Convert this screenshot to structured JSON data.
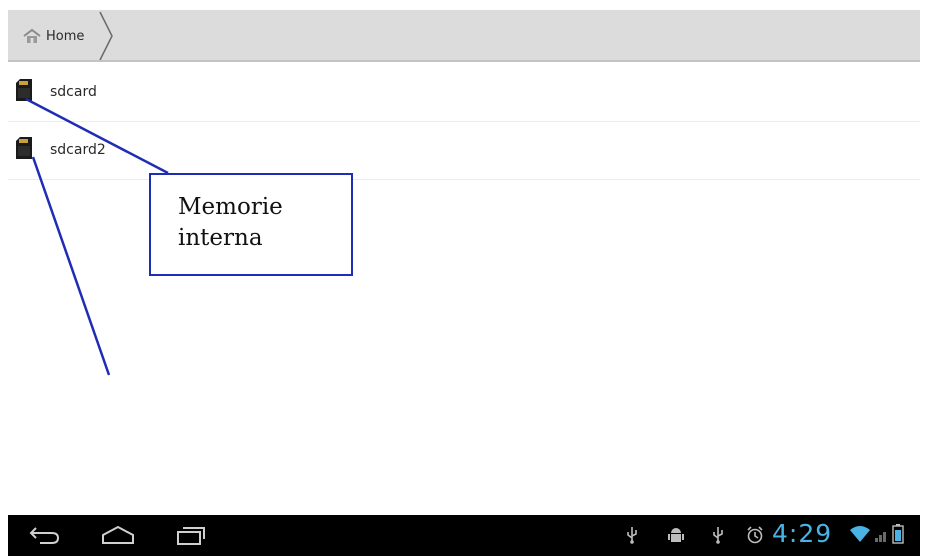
{
  "breadcrumb": {
    "home_label": "Home",
    "home_icon": "home-icon",
    "separator_icon": "chevron-right-icon"
  },
  "storage_list": [
    {
      "label": "sdcard",
      "icon": "sd-card-icon"
    },
    {
      "label": "sdcard2",
      "icon": "sd-card-icon"
    }
  ],
  "annotation": {
    "line1": "Memorie",
    "line2": "interna",
    "color": "#1f2cb5"
  },
  "nav_bar": {
    "back_icon": "back-icon",
    "home_icon": "home-outline-icon",
    "recents_icon": "recent-apps-icon"
  },
  "status_bar": {
    "time": "4:29",
    "icons": [
      "usb-icon",
      "android-debug-icon",
      "usb-icon",
      "alarm-icon",
      "wifi-icon",
      "signal-icon",
      "battery-icon"
    ],
    "clock_color": "#4ab3e6"
  }
}
